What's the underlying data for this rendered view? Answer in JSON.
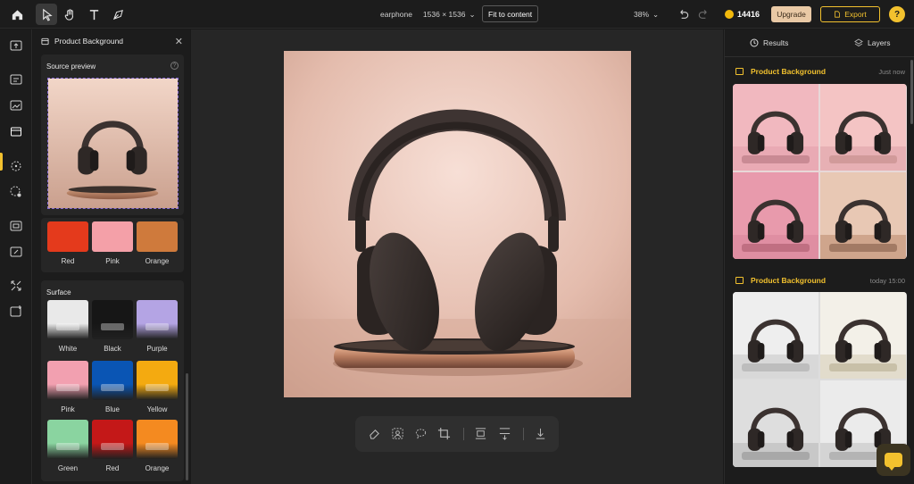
{
  "topbar": {
    "file_name": "earphone",
    "dimensions": "1536 × 1536",
    "dimensions_caret": "⌄",
    "fit_label": "Fit to content",
    "zoom": "38%",
    "zoom_caret": "⌄",
    "credits": "14416",
    "upgrade_label": "Upgrade",
    "export_label": "Export",
    "help_label": "?"
  },
  "left_panel": {
    "title": "Product Background",
    "close": "✕",
    "source_preview_title": "Source preview",
    "color_swatches": [
      {
        "label": "Red",
        "color": "#e43a1c"
      },
      {
        "label": "Pink",
        "color": "#f4a0a8"
      },
      {
        "label": "Orange",
        "color": "#cf7a3c"
      }
    ],
    "surface_title": "Surface",
    "surface_swatches": [
      {
        "label": "White",
        "color": "#e9e9e9"
      },
      {
        "label": "Black",
        "color": "#161616"
      },
      {
        "label": "Purple",
        "color": "#b4a4e4"
      },
      {
        "label": "Pink",
        "color": "#f2a0b0"
      },
      {
        "label": "Blue",
        "color": "#0a55b4"
      },
      {
        "label": "Yellow",
        "color": "#f4aa10"
      },
      {
        "label": "Green",
        "color": "#8ad4a0"
      },
      {
        "label": "Red",
        "color": "#c41818"
      },
      {
        "label": "Orange",
        "color": "#f48a20"
      }
    ]
  },
  "right_panel": {
    "tabs": [
      "Results",
      "Layers"
    ],
    "result_groups": [
      {
        "title": "Product Background",
        "time": "Just now"
      },
      {
        "title": "Product Background",
        "time": "today 15:00"
      }
    ]
  },
  "colors": {
    "accent": "#f2c12e",
    "upgrade_bg": "#e9c9a5",
    "canvas_bg": "#262626",
    "panel_bg": "#1c1c1c"
  }
}
